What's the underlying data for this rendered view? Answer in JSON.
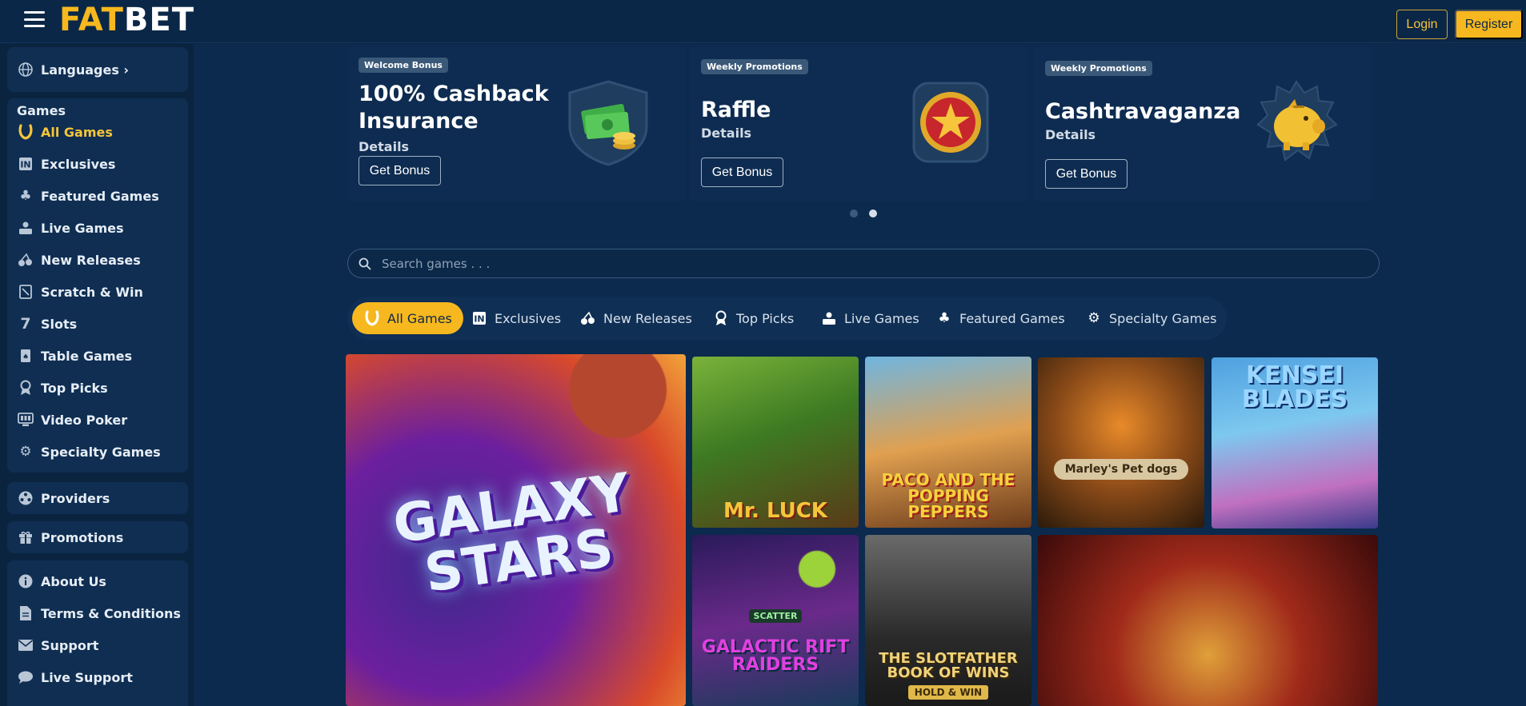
{
  "header": {
    "logo_fat": "FAT",
    "logo_bet": "BET",
    "login_label": "Login",
    "register_label": "Register"
  },
  "sidebar": {
    "languages_label": "Languages ›",
    "games_heading": "Games",
    "games": [
      {
        "label": "All Games",
        "icon": "horseshoe-icon",
        "active": true
      },
      {
        "label": "Exclusives",
        "icon": "exclusive-icon"
      },
      {
        "label": "Featured Games",
        "icon": "clover-icon"
      },
      {
        "label": "Live Games",
        "icon": "live-dealer-icon"
      },
      {
        "label": "New Releases",
        "icon": "cherries-icon"
      },
      {
        "label": "Scratch & Win",
        "icon": "scratch-card-icon"
      },
      {
        "label": "Slots",
        "icon": "seven-icon"
      },
      {
        "label": "Table Games",
        "icon": "playing-card-icon"
      },
      {
        "label": "Top Picks",
        "icon": "award-icon"
      },
      {
        "label": "Video Poker",
        "icon": "video-poker-icon"
      },
      {
        "label": "Specialty Games",
        "icon": "gear-icon"
      }
    ],
    "providers_label": "Providers",
    "promotions_label": "Promotions",
    "info": [
      {
        "label": "About Us",
        "icon": "info-icon"
      },
      {
        "label": "Terms & Conditions",
        "icon": "document-icon"
      },
      {
        "label": "Support",
        "icon": "mail-icon"
      },
      {
        "label": "Live Support",
        "icon": "chat-icon"
      }
    ]
  },
  "promos": [
    {
      "tag": "Welcome Bonus",
      "title_line1": "100% Cashback",
      "title_line2": "Insurance",
      "details": "Details",
      "button": "Get Bonus",
      "art": "cash-shield-icon"
    },
    {
      "tag": "Weekly Promotions",
      "title_line1": "Raffle",
      "details": "Details",
      "button": "Get Bonus",
      "art": "star-coin-icon"
    },
    {
      "tag": "Weekly Promotions",
      "title_line1": "Cashtravaganza",
      "details": "Details",
      "button": "Get Bonus",
      "art": "piggy-bank-icon"
    }
  ],
  "search": {
    "placeholder": "Search games . . ."
  },
  "tabs": [
    {
      "label": "All Games",
      "icon": "horseshoe-icon",
      "active": true
    },
    {
      "label": "Exclusives",
      "icon": "exclusive-icon"
    },
    {
      "label": "New Releases",
      "icon": "cherries-icon"
    },
    {
      "label": "Top Picks",
      "icon": "award-icon"
    },
    {
      "label": "Live Games",
      "icon": "live-dealer-icon"
    },
    {
      "label": "Featured Games",
      "icon": "clover-icon"
    },
    {
      "label": "Specialty Games",
      "icon": "gear-icon"
    }
  ],
  "games": [
    {
      "title": "GALAXY STARS"
    },
    {
      "title": "Mr. LUCK"
    },
    {
      "title": "PACO AND THE POPPING PEPPERS"
    },
    {
      "title": "Marley's Pet dogs"
    },
    {
      "title": "KENSEI BLADES"
    },
    {
      "title": "GALACTIC RIFT RAIDERS",
      "badge": "SCATTER"
    },
    {
      "title": "THE SLOTFATHER BOOK OF WINS",
      "subtitle": "HOLD & WIN"
    },
    {
      "title": ""
    }
  ],
  "colors": {
    "accent": "#f6b81e",
    "bg": "#0a2440",
    "panel": "#0f2e52"
  }
}
